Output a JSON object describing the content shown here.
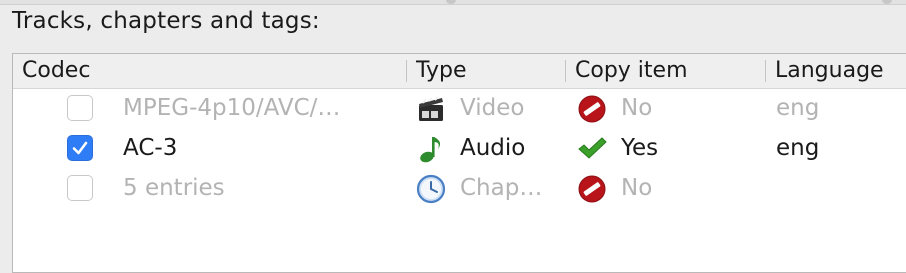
{
  "group": {
    "title": "Tracks, chapters and tags:"
  },
  "columns": {
    "codec": "Codec",
    "type": "Type",
    "copy_item": "Copy item",
    "language": "Language"
  },
  "rows": [
    {
      "checked": false,
      "enabled": false,
      "codec": "MPEG-4p10/AVC/…",
      "type_icon": "film-clapper-icon",
      "type": "Video",
      "copy_icon": "no-entry-icon",
      "copy": "No",
      "language": "eng"
    },
    {
      "checked": true,
      "enabled": true,
      "codec": "AC-3",
      "type_icon": "music-note-icon",
      "type": "Audio",
      "copy_icon": "checkmark-icon",
      "copy": "Yes",
      "language": "eng"
    },
    {
      "checked": false,
      "enabled": false,
      "codec": "5 entries",
      "type_icon": "clock-icon",
      "type": "Chap…",
      "copy_icon": "no-entry-icon",
      "copy": "No",
      "language": ""
    }
  ],
  "colors": {
    "checkbox_accent": "#2f7df6",
    "no_entry_red": "#b8151b",
    "checkmark_green": "#3aa02a"
  }
}
